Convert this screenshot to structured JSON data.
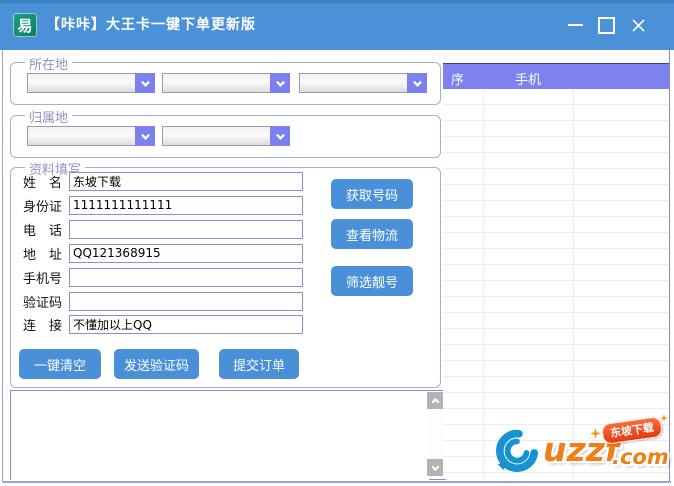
{
  "window": {
    "title": "【咔咔】大王卡一键下单更新版",
    "app_icon_char": "易"
  },
  "groups": {
    "location_label": "所在地",
    "home_label": "归属地",
    "profile_label": "资料填写"
  },
  "form": {
    "fields": [
      {
        "label": "姓　名",
        "value": "东坡下载"
      },
      {
        "label": "身份证",
        "value": "1111111111111"
      },
      {
        "label": "电　话",
        "value": ""
      },
      {
        "label": "地　址",
        "value": "QQ121368915"
      },
      {
        "label": "手机号",
        "value": ""
      },
      {
        "label": "验证码",
        "value": ""
      },
      {
        "label": "连　接",
        "value": "不懂加以上QQ"
      }
    ]
  },
  "side_buttons": {
    "get_number": "获取号码",
    "check_logistics": "查看物流",
    "filter_numbers": "筛选靓号"
  },
  "bottom_buttons": {
    "clear_all": "一键清空",
    "send_code": "发送验证码",
    "submit_order": "提交订单"
  },
  "table": {
    "col_seq": "序",
    "col_phone": "手机"
  },
  "log": {
    "value": ""
  },
  "watermark": {
    "main": "uzzf",
    "suffix": ".com",
    "badge": "东坡下载"
  },
  "colors": {
    "titlebar": "#4a91d8",
    "accent_blue": "#4a90d8",
    "combo_purple": "#7b80f1",
    "table_header_purple": "#7e82ee",
    "group_border": "#a9ace0"
  }
}
